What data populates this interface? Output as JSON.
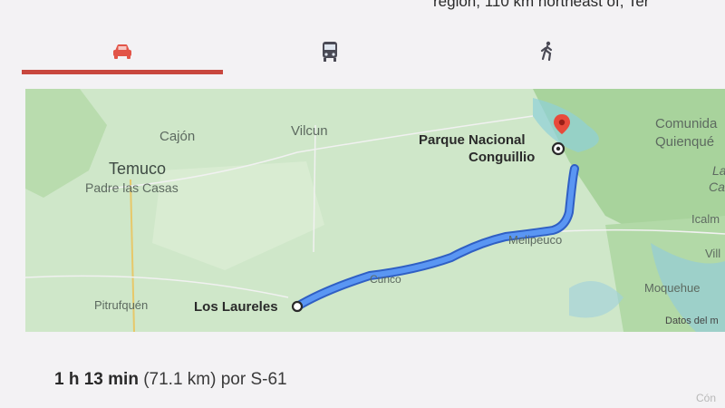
{
  "header": {
    "description": "región, 110 km northeast of, Ter"
  },
  "mode_tabs": [
    {
      "icon": "car-icon",
      "selected": true
    },
    {
      "icon": "bus-icon",
      "selected": false
    },
    {
      "icon": "walking-icon",
      "selected": false
    }
  ],
  "colors": {
    "accent": "#c8473e",
    "route": "#4a8af0",
    "route_border": "#2f5fc4",
    "map_land": "#cfe7c9",
    "destination_pin": "#e84a3b"
  },
  "map": {
    "places": {
      "cajon": "Cajón",
      "vilcun": "Vilcun",
      "temuco": "Temuco",
      "padre_las_casas": "Padre las Casas",
      "pitrufquen": "Pitrufquén",
      "cunco": "Cunco",
      "melipeuco": "Melipeuco",
      "comunidad_1": "Comunida",
      "comunidad_2": "Quienqué",
      "la": "La",
      "ca": "Ca",
      "icalma": "Icalm",
      "vill": "Vill",
      "moquehue": "Moquehue"
    },
    "origin": "Los Laureles",
    "destination_line1": "Parque Nacional",
    "destination_line2": "Conguillio",
    "attribution": "Datos del m"
  },
  "route_summary": {
    "duration": "1 h 13 min",
    "distance": "(71.1 km)",
    "via": "por S-61"
  },
  "footer": {
    "corner_text": "Cón"
  }
}
